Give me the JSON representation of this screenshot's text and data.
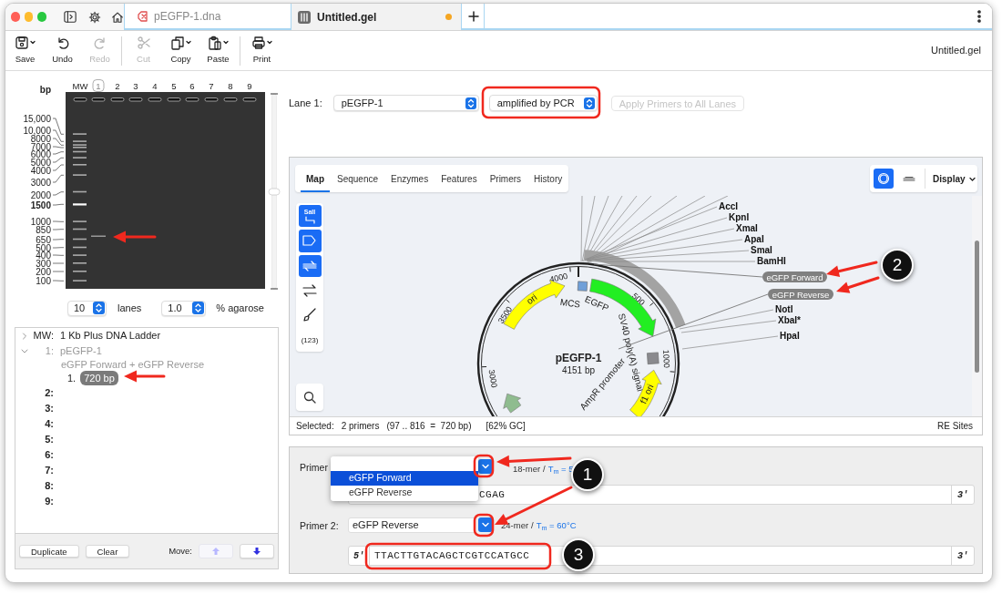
{
  "tabs": [
    {
      "label": "pEGFP-1.dna",
      "selected": false,
      "modified": false
    },
    {
      "label": "Untitled.gel",
      "selected": true,
      "modified": true
    }
  ],
  "toolbar": [
    [
      {
        "kind": "save",
        "label": "Save",
        "disabled": false,
        "menu": true
      },
      {
        "kind": "undo",
        "label": "Undo",
        "disabled": false,
        "menu": false
      },
      {
        "kind": "redo",
        "label": "Redo",
        "disabled": true,
        "menu": false
      }
    ],
    [
      {
        "kind": "cut",
        "label": "Cut",
        "disabled": true,
        "menu": false
      },
      {
        "kind": "copy",
        "label": "Copy",
        "disabled": false,
        "menu": true
      },
      {
        "kind": "paste",
        "label": "Paste",
        "disabled": false,
        "menu": true
      }
    ],
    [
      {
        "kind": "print",
        "label": "Print",
        "disabled": false,
        "menu": true
      }
    ]
  ],
  "document_title": "Untitled.gel",
  "gel": {
    "unit": "bp",
    "lanes": [
      {
        "label": "MW",
        "selected": false
      },
      {
        "label": "1",
        "selected": true
      },
      {
        "label": "2",
        "selected": false
      },
      {
        "label": "3",
        "selected": false
      },
      {
        "label": "4",
        "selected": false
      },
      {
        "label": "5",
        "selected": false
      },
      {
        "label": "6",
        "selected": false
      },
      {
        "label": "7",
        "selected": false
      },
      {
        "label": "8",
        "selected": false
      },
      {
        "label": "9",
        "selected": false
      }
    ],
    "ladder": [
      {
        "label": "15,000",
        "bold": false
      },
      {
        "label": "10,000",
        "bold": false
      },
      {
        "label": "8000",
        "bold": false
      },
      {
        "label": "7000",
        "bold": false
      },
      {
        "label": "6000",
        "bold": false
      },
      {
        "label": "5000",
        "bold": false
      },
      {
        "label": "4000",
        "bold": false
      },
      {
        "label": "3000",
        "bold": false
      },
      {
        "label": "2000",
        "bold": false
      },
      {
        "label": "1500",
        "bold": true
      },
      {
        "label": "1000",
        "bold": false
      },
      {
        "label": "850",
        "bold": false
      },
      {
        "label": "650",
        "bold": false
      },
      {
        "label": "500",
        "bold": false
      },
      {
        "label": "400",
        "bold": false
      },
      {
        "label": "300",
        "bold": false
      },
      {
        "label": "200",
        "bold": false
      },
      {
        "label": "100",
        "bold": false
      }
    ],
    "zoom_slider": {
      "level": 0.5
    },
    "lane_count": "10",
    "lane_count_label": "lanes",
    "agarose": "1.0",
    "agarose_label": "% agarose"
  },
  "lane_list": [
    {
      "label": "MW:",
      "name": "1 Kb Plus DNA Ladder",
      "expanded": false,
      "dimmed": false
    },
    {
      "label": "1:",
      "name": "pEGFP-1",
      "detail": "eGFP Forward + eGFP Reverse",
      "expanded": true,
      "dimmed": true,
      "children": [
        {
          "label": "1.",
          "band": "720 bp",
          "selected": true
        }
      ]
    },
    {
      "label": "2:"
    },
    {
      "label": "3:"
    },
    {
      "label": "4:"
    },
    {
      "label": "5:"
    },
    {
      "label": "6:"
    },
    {
      "label": "7:"
    },
    {
      "label": "8:"
    },
    {
      "label": "9:"
    }
  ],
  "list_buttons": [
    "Duplicate",
    "Clear"
  ],
  "move_label": "Move:",
  "move_buttons": [
    {
      "kind": "up",
      "disabled": true
    },
    {
      "kind": "down",
      "disabled": false
    }
  ],
  "lane_selector": {
    "label": "Lane 1:",
    "value": "pEGFP-1"
  },
  "product_select": "amplified by PCR",
  "apply_button": {
    "label": "Apply Primers to All Lanes",
    "disabled": true
  },
  "map": {
    "tabs": [
      {
        "label": "Map",
        "selected": true
      },
      {
        "label": "Sequence",
        "selected": false
      },
      {
        "label": "Enzymes",
        "selected": false
      },
      {
        "label": "Features",
        "selected": false
      },
      {
        "label": "Primers",
        "selected": false
      },
      {
        "label": "History",
        "selected": false
      }
    ],
    "view_buttons": [
      {
        "kind": "circular",
        "selected": true
      },
      {
        "kind": "linear",
        "selected": false
      }
    ],
    "display": "Display",
    "tools": [
      {
        "kind": "enzymes",
        "label": "SalI",
        "selected": true
      },
      {
        "kind": "features",
        "selected": true
      },
      {
        "kind": "primers",
        "selected": true
      },
      {
        "kind": "orfs",
        "selected": false
      },
      {
        "kind": "colors",
        "selected": false
      },
      {
        "kind": "numbers",
        "label": "(123)",
        "selected": false
      }
    ],
    "name": "pEGFP-1",
    "size": "4151 bp",
    "ticks": [
      "4000",
      "500",
      "3500",
      "1000",
      "3000"
    ],
    "features": [
      {
        "label": "ori",
        "color": "#ffff00"
      },
      {
        "label": "EGFP",
        "color": "#22ee22"
      },
      {
        "label": "MCS",
        "color": "#6f9fd8"
      },
      {
        "label": "SV40 poly(A) signal",
        "color": "#8a8a8e"
      },
      {
        "label": "f1 ori",
        "color": "#ffff00"
      },
      {
        "label": "AmpR promoter"
      },
      {
        "color": "#8fbc8f"
      }
    ],
    "enzymes": [
      "AccI",
      "KpnI",
      "XmaI",
      "ApaI",
      "SmaI",
      "BamHI",
      "NotI",
      "XbaI*",
      "HpaI"
    ],
    "primers": [
      "eGFP Forward",
      "eGFP Reverse"
    ],
    "status": {
      "label": "Selected:",
      "count": "2 primers",
      "range": "(97 .. 816  =  720 bp)",
      "gc": "[62% GC]",
      "right": "RE Sites"
    }
  },
  "primers": [
    {
      "label": "Primer",
      "length": "18-mer",
      "separator": "/",
      "tm": "T$_{m}$ = 5",
      "sequence": "CGAG",
      "three_prime": "3'",
      "menu": [
        {
          "label": "eGFP Forward",
          "selected": true
        },
        {
          "label": "eGFP Reverse",
          "selected": false
        }
      ]
    },
    {
      "label": "Primer 2:",
      "value": "eGFP Reverse",
      "length": "24-mer",
      "separator": "/",
      "tm": "T$_{m}$ = 60°C",
      "five_prime": "5'",
      "sequence": "TTACTTGTACAGCTCGTCCATGCC",
      "three_prime": "3'"
    }
  ],
  "callouts": [
    {
      "number": "1"
    },
    {
      "number": "2"
    },
    {
      "number": "3"
    }
  ]
}
